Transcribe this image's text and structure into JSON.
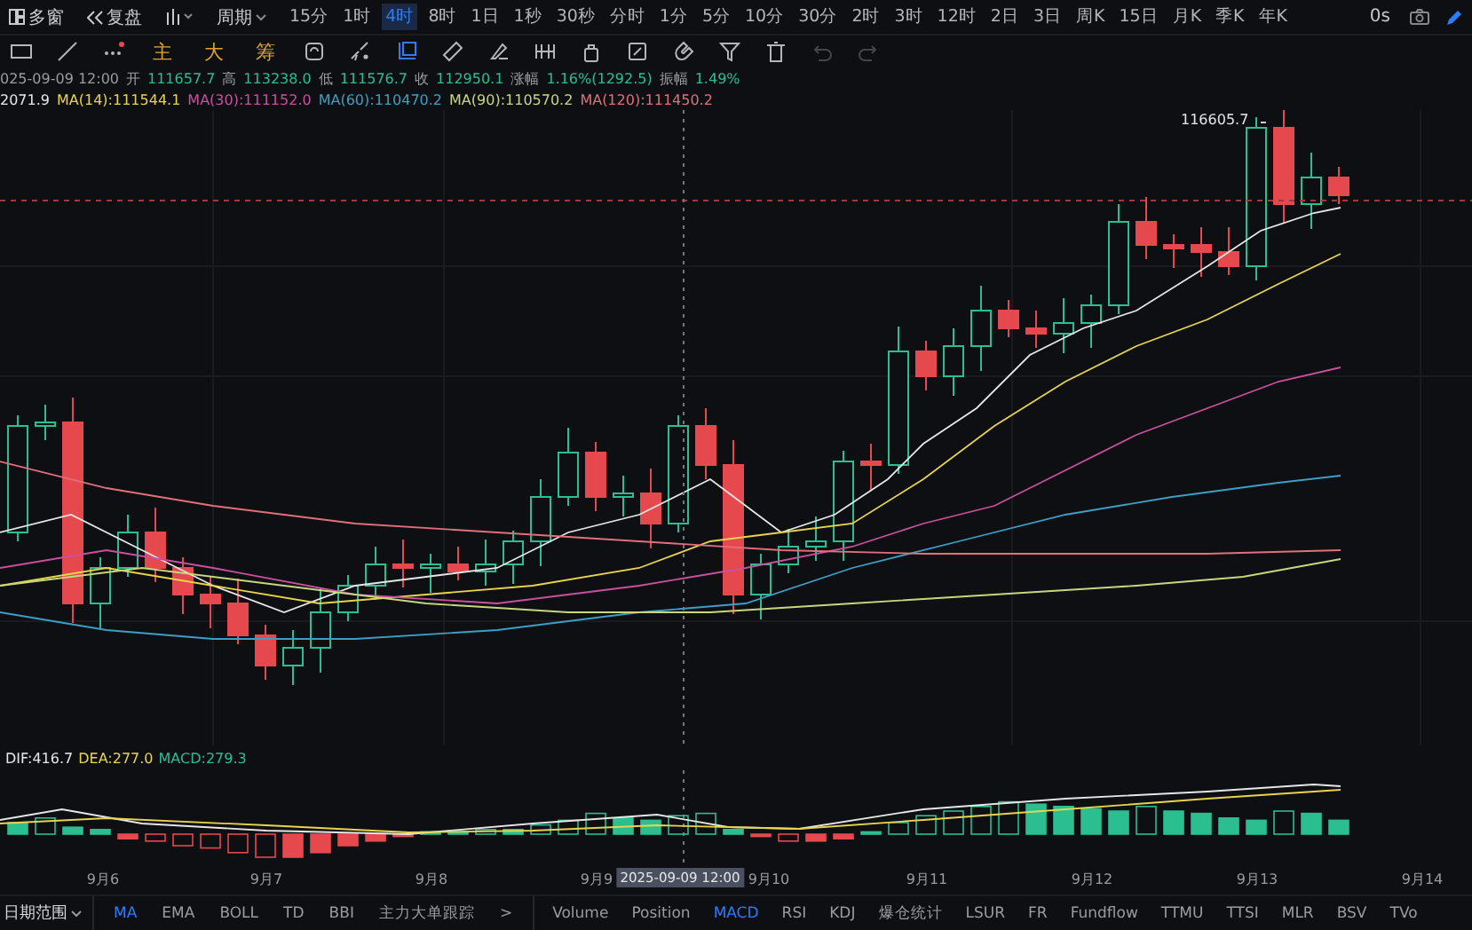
{
  "toolbar": {
    "layout_button": "多窗",
    "replay_button": "复盘",
    "period_menu": "周期",
    "intervals": [
      {
        "label": "15分",
        "selected": false
      },
      {
        "label": "1时",
        "selected": false
      },
      {
        "label": "4时",
        "selected": true
      },
      {
        "label": "8时",
        "selected": false
      },
      {
        "label": "1日",
        "selected": false
      },
      {
        "label": "1秒",
        "selected": false
      },
      {
        "label": "30秒",
        "selected": false
      },
      {
        "label": "分时",
        "selected": false
      },
      {
        "label": "1分",
        "selected": false
      },
      {
        "label": "5分",
        "selected": false
      },
      {
        "label": "10分",
        "selected": false
      },
      {
        "label": "30分",
        "selected": false
      },
      {
        "label": "2时",
        "selected": false
      },
      {
        "label": "3时",
        "selected": false
      },
      {
        "label": "12时",
        "selected": false
      },
      {
        "label": "2日",
        "selected": false
      },
      {
        "label": "3日",
        "selected": false
      },
      {
        "label": "周K",
        "selected": false
      },
      {
        "label": "15日",
        "selected": false
      },
      {
        "label": "月K",
        "selected": false
      },
      {
        "label": "季K",
        "selected": false
      },
      {
        "label": "年K",
        "selected": false
      }
    ],
    "countdown": "0s"
  },
  "chart_toggles": [
    {
      "label": "主"
    },
    {
      "label": "大"
    },
    {
      "label": "筹"
    }
  ],
  "ohlc": [
    {
      "value": "025-09-09 12:00"
    },
    {
      "label": "开",
      "value": "111657.7"
    },
    {
      "label": "高",
      "value": "113238.0"
    },
    {
      "label": "低",
      "value": "111576.7"
    },
    {
      "label": "收",
      "value": "112950.1"
    },
    {
      "label": "涨幅",
      "value": "1.16%(1292.5)"
    },
    {
      "label": "振幅",
      "value": "1.49%"
    }
  ],
  "moving_averages": [
    {
      "label": "2071.9",
      "color": "#e6e6e6"
    },
    {
      "label": "MA(14):111544.1",
      "color": "#e8d44d"
    },
    {
      "label": "MA(30):111152.0",
      "color": "#c9509f"
    },
    {
      "label": "MA(60):110470.2",
      "color": "#3d9fc4"
    },
    {
      "label": "MA(90):110570.2",
      "color": "#c7d77e"
    },
    {
      "label": "MA(120):111450.2",
      "color": "#e0707a"
    }
  ],
  "high_marker": "116605.7",
  "macd": [
    {
      "label": "DIF:416.7",
      "color": "#e6e6e6"
    },
    {
      "label": "DEA:277.0",
      "color": "#e8d44d"
    },
    {
      "label": "MACD:279.3",
      "color": "#2bbf8f"
    }
  ],
  "date_axis": [
    "9月6",
    "9月7",
    "9月8",
    "9月9",
    "9月10",
    "9月11",
    "9月12",
    "9月13",
    "9月14"
  ],
  "crosshair_time": "2025-09-09 12:00",
  "bottom_bar": {
    "range_menu": "日期范围",
    "main_indicators": [
      {
        "label": "MA",
        "selected": true
      },
      {
        "label": "EMA",
        "selected": false
      },
      {
        "label": "BOLL",
        "selected": false
      },
      {
        "label": "TD",
        "selected": false
      },
      {
        "label": "BBI",
        "selected": false
      },
      {
        "label": "主力大单跟踪",
        "selected": false
      }
    ],
    "more": ">",
    "sub_indicators": [
      {
        "label": "Volume",
        "selected": false
      },
      {
        "label": "Position",
        "selected": false
      },
      {
        "label": "MACD",
        "selected": true
      },
      {
        "label": "RSI",
        "selected": false
      },
      {
        "label": "KDJ",
        "selected": false
      },
      {
        "label": "爆仓统计",
        "selected": false
      },
      {
        "label": "LSUR",
        "selected": false
      },
      {
        "label": "FR",
        "selected": false
      },
      {
        "label": "Fundflow",
        "selected": false
      },
      {
        "label": "TTMU",
        "selected": false
      },
      {
        "label": "TTSI",
        "selected": false
      },
      {
        "label": "MLR",
        "selected": false
      },
      {
        "label": "BSV",
        "selected": false
      },
      {
        "label": "TVo",
        "selected": false
      }
    ]
  }
}
